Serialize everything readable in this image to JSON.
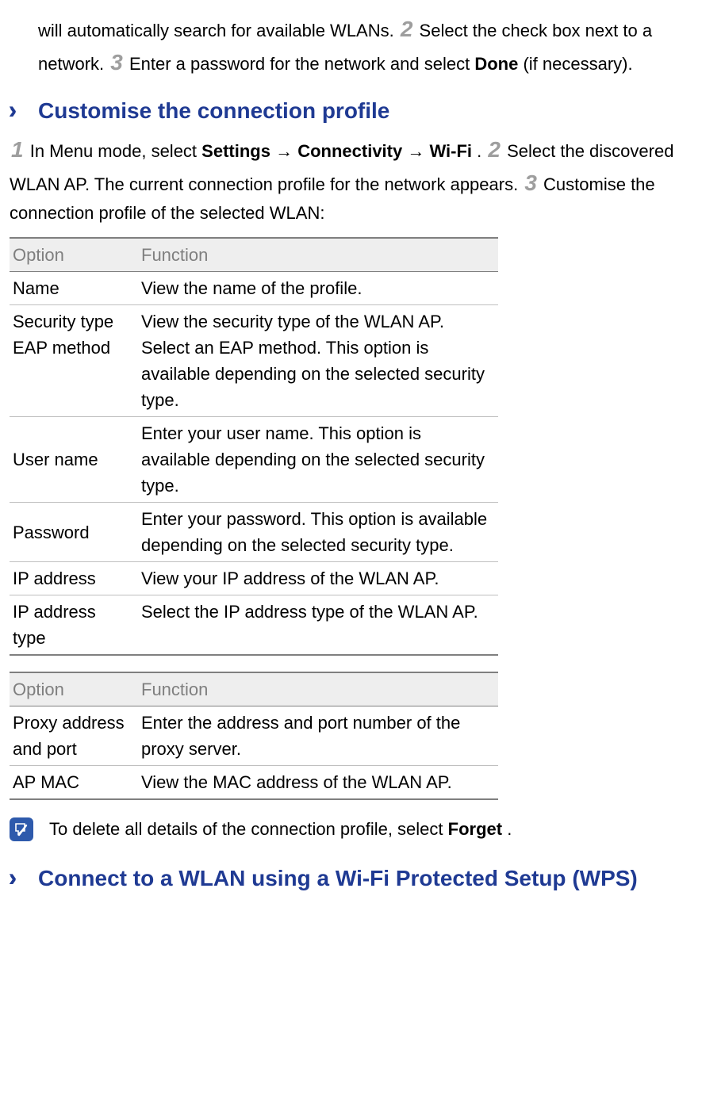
{
  "intro": {
    "frag1": "will automatically search for available WLANs. ",
    "step2": "2",
    "frag2": " Select the check box next to a network. ",
    "step3": "3",
    "frag3": " Enter a password for the network and select ",
    "done": "Done",
    "frag4": " (if necessary)."
  },
  "section1": {
    "title": "Customise the connection profile",
    "p": {
      "s1": "1",
      "t1": " In Menu mode, select ",
      "b1": "Settings",
      "arrow1": " →",
      "b2": "Connectivity",
      "arrow2": " →",
      "b3": "Wi-Fi",
      "t2": ". ",
      "s2": "2",
      "t3": " Select the discovered WLAN AP. The current connection profile for the network appears. ",
      "s3": "3",
      "t4": " Customise the connection profile of the selected WLAN:"
    }
  },
  "table1": {
    "h1": "Option",
    "h2": "Function",
    "rows": [
      {
        "opt": "Name",
        "fn": "View the name of the profile."
      },
      {
        "opt": "Security type EAP method",
        "fn": "View the security type of the WLAN AP. Select an EAP method. This option is available depending on the selected security type."
      },
      {
        "opt": "User name",
        "fn": "Enter your user name. This option is available depending on the selected security type."
      },
      {
        "opt": "Password",
        "fn": "Enter your password. This option is available depending on the selected security type."
      },
      {
        "opt": "IP address",
        "fn": "View your IP address of the WLAN AP."
      },
      {
        "opt": "IP address type",
        "fn": "Select the IP address type of the WLAN AP."
      }
    ]
  },
  "table2": {
    "h1": "Option",
    "h2": "Function",
    "rows": [
      {
        "opt": "Proxy address and port",
        "fn": "Enter the address and port number of the proxy server."
      },
      {
        "opt": "AP MAC",
        "fn": "View the MAC address of the WLAN AP."
      }
    ]
  },
  "note": {
    "t1": "To delete all details of the connection profile, select ",
    "b1": "Forget",
    "t2": "."
  },
  "section2": {
    "title": "Connect to a WLAN using a Wi-Fi Protected Setup (WPS)"
  }
}
